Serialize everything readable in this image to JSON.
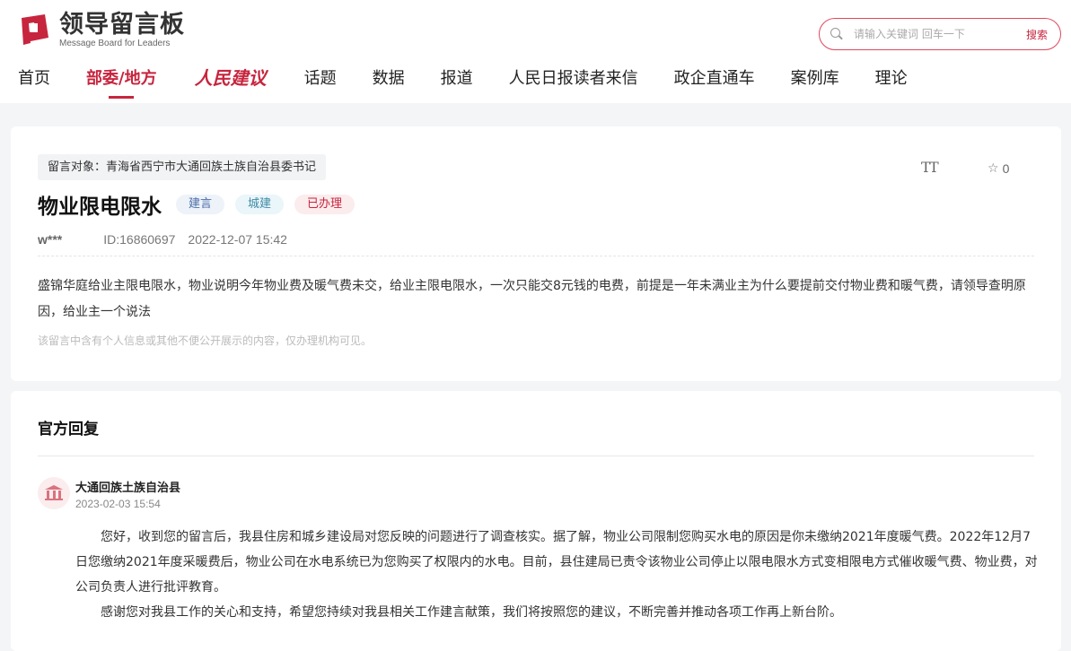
{
  "logo": {
    "name_cn": "领导留言板",
    "name_en": "Message Board for Leaders",
    "brand_color": "#c7253e"
  },
  "search": {
    "placeholder": "请输入关键词 回车一下",
    "button_label": "搜索"
  },
  "nav": {
    "items": [
      {
        "label": "首页"
      },
      {
        "label": "部委/地方",
        "active": true
      },
      {
        "label": "人民建议"
      },
      {
        "label": "话题"
      },
      {
        "label": "数据"
      },
      {
        "label": "报道"
      },
      {
        "label": "人民日报读者来信"
      },
      {
        "label": "政企直通车"
      },
      {
        "label": "案例库"
      },
      {
        "label": "理论"
      }
    ]
  },
  "message": {
    "target": "留言对象：青海省西宁市大通回族土族自治县委书记",
    "title": "物业限电限水",
    "tags": [
      "建言",
      "城建",
      "已办理"
    ],
    "user": "w***",
    "id": "ID:16860697",
    "datetime": "2022-12-07 15:42",
    "star_count": "0",
    "font_tool": "TT",
    "content": "盛锦华庭给业主限电限水，物业说明今年物业费及暖气费未交，给业主限电限水，一次只能交8元钱的电费，前提是一年未满业主为什么要提前交付物业费和暖气费，请领导查明原因，给业主一个说法",
    "privacy_note": "该留言中含有个人信息或其他不便公开展示的内容，仅办理机构可见。"
  },
  "reply": {
    "section_title": "官方回复",
    "org": "大通回族土族自治县",
    "date": "2023-02-03 15:54",
    "paragraphs": [
      "您好，收到您的留言后，我县住房和城乡建设局对您反映的问题进行了调查核实。据了解，物业公司限制您购买水电的原因是你未缴纳2021年度暖气费。2022年12月7日您缴纳2021年度采暖费后，物业公司在水电系统已为您购买了权限内的水电。目前，县住建局已责令该物业公司停止以限电限水方式变相限电方式催收暖气费、物业费，对公司负责人进行批评教育。",
      "感谢您对我县工作的关心和支持，希望您持续对我县相关工作建言献策，我们将按照您的建议，不断完善并推动各项工作再上新台阶。"
    ]
  }
}
